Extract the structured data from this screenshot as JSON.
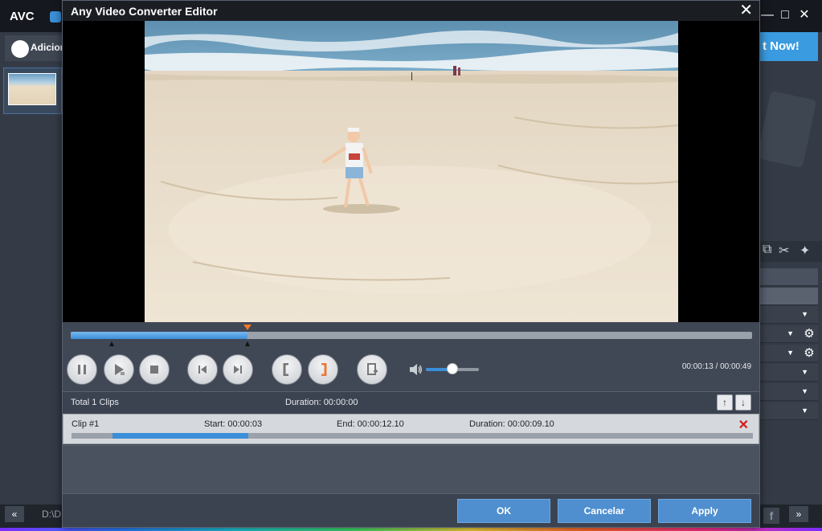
{
  "background_app": {
    "logo": "AVC",
    "add_button_label": "Adicion",
    "convert_button_label": "t Now!",
    "path_text": "D:\\D",
    "facebook_glyph": "f",
    "nav_left_glyph": "«",
    "nav_right_glyph": "»"
  },
  "dialog": {
    "title": "Any Video Converter Editor",
    "close_glyph": "✕"
  },
  "playback": {
    "current_time": "00:00:13",
    "total_time": "00:00:49",
    "time_readout": "00:00:13 / 00:00:49",
    "progress_fraction": 0.26,
    "volume_fraction": 0.5
  },
  "clips": {
    "total_label": "Total 1 Clips",
    "duration_label": "Duration: 00:00:00",
    "up_glyph": "↑",
    "down_glyph": "↓",
    "items": [
      {
        "name": "Clip #1",
        "start": "Start: 00:00:03",
        "end": "End: 00:00:12.10",
        "duration": "Duration: 00:00:09.10",
        "remove_glyph": "✕",
        "range_start_fraction": 0.06,
        "range_end_fraction": 0.26
      }
    ]
  },
  "buttons": {
    "ok": "OK",
    "cancel": "Cancelar",
    "apply": "Apply"
  },
  "colors": {
    "accent": "#3a8fd8",
    "button_blue": "#4f8fcf",
    "playhead_orange": "#f07a2a",
    "remove_red": "#d01c1c"
  }
}
